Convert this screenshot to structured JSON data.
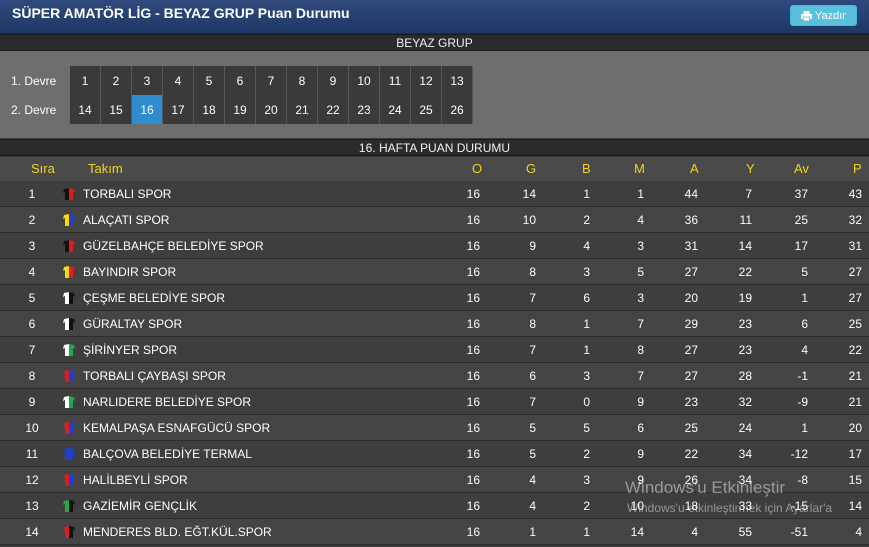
{
  "header": {
    "title": "SÜPER AMATÖR LİG - BEYAZ GRUP Puan Durumu",
    "print_label": "Yazdır"
  },
  "group_title": "BEYAZ GRUP",
  "devre": [
    {
      "label": "1. Devre",
      "weeks": [
        "1",
        "2",
        "3",
        "4",
        "5",
        "6",
        "7",
        "8",
        "9",
        "10",
        "11",
        "12",
        "13"
      ]
    },
    {
      "label": "2. Devre",
      "weeks": [
        "14",
        "15",
        "16",
        "17",
        "18",
        "19",
        "20",
        "21",
        "22",
        "23",
        "24",
        "25",
        "26"
      ]
    }
  ],
  "active_week": "16",
  "standings_title": "16. HAFTA PUAN DURUMU",
  "columns": {
    "rank": "Sıra",
    "team": "Takım",
    "played": "O",
    "won": "G",
    "drawn": "B",
    "lost": "M",
    "gf": "A",
    "ga": "Y",
    "gd": "Av",
    "pts": "P"
  },
  "rows": [
    {
      "rank": "1",
      "team": "TORBALI SPOR",
      "kit": [
        "#111111",
        "#d42020"
      ],
      "o": "16",
      "g": "14",
      "b": "1",
      "m": "1",
      "a": "44",
      "y": "7",
      "av": "37",
      "p": "43"
    },
    {
      "rank": "2",
      "team": "ALAÇATI SPOR",
      "kit": [
        "#ffd800",
        "#1f3fd1"
      ],
      "o": "16",
      "g": "10",
      "b": "2",
      "m": "4",
      "a": "36",
      "y": "11",
      "av": "25",
      "p": "32"
    },
    {
      "rank": "3",
      "team": "GÜZELBAHÇE BELEDİYE SPOR",
      "kit": [
        "#111111",
        "#d42020"
      ],
      "o": "16",
      "g": "9",
      "b": "4",
      "m": "3",
      "a": "31",
      "y": "14",
      "av": "17",
      "p": "31"
    },
    {
      "rank": "4",
      "team": "BAYINDIR SPOR",
      "kit": [
        "#ffd800",
        "#d42020"
      ],
      "o": "16",
      "g": "8",
      "b": "3",
      "m": "5",
      "a": "27",
      "y": "22",
      "av": "5",
      "p": "27"
    },
    {
      "rank": "5",
      "team": "ÇEŞME BELEDİYE SPOR",
      "kit": [
        "#ffffff",
        "#111111"
      ],
      "o": "16",
      "g": "7",
      "b": "6",
      "m": "3",
      "a": "20",
      "y": "19",
      "av": "1",
      "p": "27"
    },
    {
      "rank": "6",
      "team": "GÜRALTAY SPOR",
      "kit": [
        "#ffffff",
        "#111111"
      ],
      "o": "16",
      "g": "8",
      "b": "1",
      "m": "7",
      "a": "29",
      "y": "23",
      "av": "6",
      "p": "25"
    },
    {
      "rank": "7",
      "team": "ŞİRİNYER SPOR",
      "kit": [
        "#ffffff",
        "#1ea84a"
      ],
      "o": "16",
      "g": "7",
      "b": "1",
      "m": "8",
      "a": "27",
      "y": "23",
      "av": "4",
      "p": "22"
    },
    {
      "rank": "8",
      "team": "TORBALI ÇAYBAŞI SPOR",
      "kit": [
        "#d42020",
        "#1f3fd1"
      ],
      "o": "16",
      "g": "6",
      "b": "3",
      "m": "7",
      "a": "27",
      "y": "28",
      "av": "-1",
      "p": "21"
    },
    {
      "rank": "9",
      "team": "NARLIDERE BELEDİYE SPOR",
      "kit": [
        "#ffffff",
        "#1ea84a"
      ],
      "o": "16",
      "g": "7",
      "b": "0",
      "m": "9",
      "a": "23",
      "y": "32",
      "av": "-9",
      "p": "21"
    },
    {
      "rank": "10",
      "team": "KEMALPAŞA ESNAFGÜCÜ SPOR",
      "kit": [
        "#d42020",
        "#1f3fd1"
      ],
      "o": "16",
      "g": "5",
      "b": "5",
      "m": "6",
      "a": "25",
      "y": "24",
      "av": "1",
      "p": "20"
    },
    {
      "rank": "11",
      "team": "BALÇOVA BELEDİYE TERMAL",
      "kit": [
        "#1f3fd1",
        "#1f3fd1"
      ],
      "o": "16",
      "g": "5",
      "b": "2",
      "m": "9",
      "a": "22",
      "y": "34",
      "av": "-12",
      "p": "17"
    },
    {
      "rank": "12",
      "team": "HALİLBEYLİ SPOR",
      "kit": [
        "#d42020",
        "#1f3fd1"
      ],
      "o": "16",
      "g": "4",
      "b": "3",
      "m": "9",
      "a": "26",
      "y": "34",
      "av": "-8",
      "p": "15"
    },
    {
      "rank": "13",
      "team": "GAZİEMİR GENÇLİK",
      "kit": [
        "#1ea84a",
        "#111111"
      ],
      "o": "16",
      "g": "4",
      "b": "2",
      "m": "10",
      "a": "18",
      "y": "33",
      "av": "-15",
      "p": "14"
    },
    {
      "rank": "14",
      "team": "MENDERES BLD. EĞT.KÜL.SPOR",
      "kit": [
        "#d42020",
        "#111111"
      ],
      "o": "16",
      "g": "1",
      "b": "1",
      "m": "14",
      "a": "4",
      "y": "55",
      "av": "-51",
      "p": "4"
    }
  ],
  "watermark": {
    "line1": "Windows'u Etkinleştir",
    "line2": "Windows'u etkinleştirmek için Ayarlar'a"
  }
}
